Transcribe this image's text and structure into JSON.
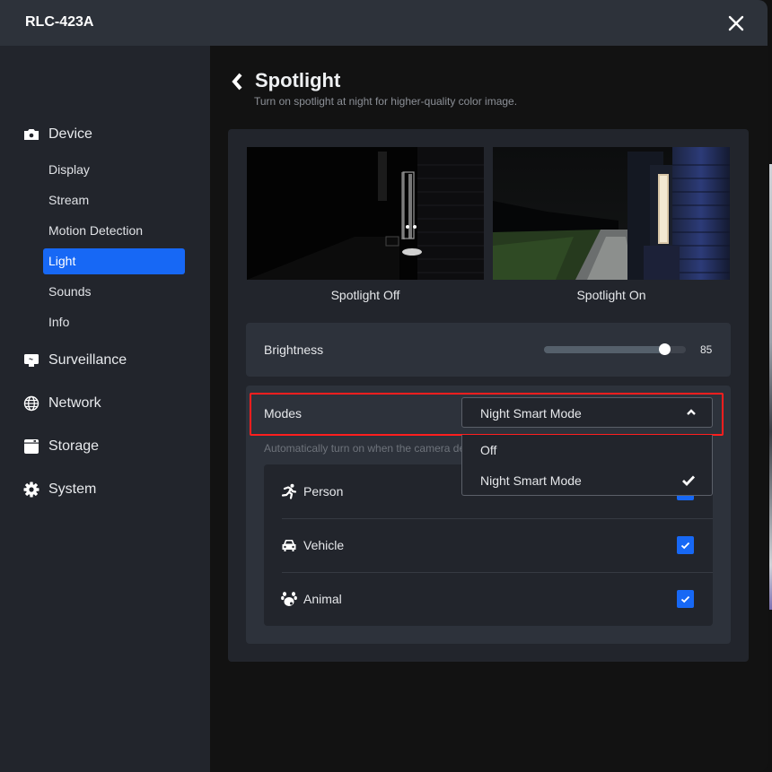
{
  "window": {
    "title": "RLC-423A",
    "close_icon": "close-icon"
  },
  "sidebar": {
    "groups": [
      {
        "label": "Device",
        "icon": "camera-icon"
      },
      {
        "label": "Surveillance",
        "icon": "monitor-icon"
      },
      {
        "label": "Network",
        "icon": "globe-icon"
      },
      {
        "label": "Storage",
        "icon": "storage-icon"
      },
      {
        "label": "System",
        "icon": "gear-icon"
      }
    ],
    "device_items": [
      {
        "label": "Display",
        "active": false
      },
      {
        "label": "Stream",
        "active": false
      },
      {
        "label": "Motion Detection",
        "active": false
      },
      {
        "label": "Light",
        "active": true
      },
      {
        "label": "Sounds",
        "active": false
      },
      {
        "label": "Info",
        "active": false
      }
    ]
  },
  "page": {
    "title": "Spotlight",
    "subtitle": "Turn on spotlight at night for higher-quality color image.",
    "back_icon": "chevron-left-icon"
  },
  "previews": [
    {
      "caption": "Spotlight Off"
    },
    {
      "caption": "Spotlight On"
    }
  ],
  "brightness": {
    "label": "Brightness",
    "value": 85,
    "value_text": "85",
    "min": 0,
    "max": 100
  },
  "modes": {
    "label": "Modes",
    "selected": "Night Smart Mode",
    "expanded": true,
    "options": [
      {
        "label": "Off",
        "selected": false
      },
      {
        "label": "Night Smart Mode",
        "selected": true
      }
    ],
    "hint": "Automatically turn on when the camera de"
  },
  "objects": [
    {
      "name": "Person",
      "icon": "running-person-icon",
      "checked": true
    },
    {
      "name": "Vehicle",
      "icon": "car-icon",
      "checked": true
    },
    {
      "name": "Animal",
      "icon": "paw-icon",
      "checked": true
    }
  ],
  "colors": {
    "accent": "#1768f5",
    "highlight_border": "#ff1e1e",
    "titlebar": "#2d323a",
    "sidebar": "#22252c",
    "card": "#2d323b"
  }
}
